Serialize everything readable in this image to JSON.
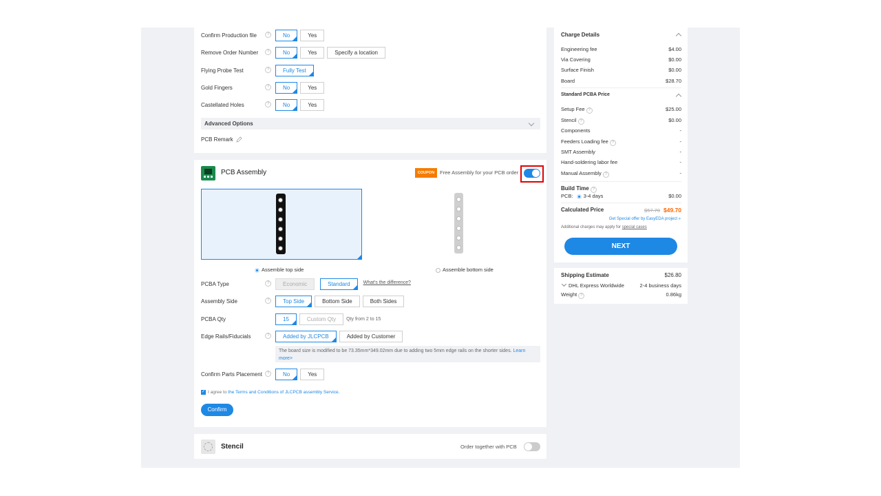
{
  "pcb_options": [
    {
      "label": "Confirm Production file",
      "options": [
        "No",
        "Yes"
      ],
      "selected": 0
    },
    {
      "label": "Remove Order Number",
      "options": [
        "No",
        "Yes",
        "Specify a location"
      ],
      "selected": 0
    },
    {
      "label": "Flying Probe Test",
      "options": [
        "Fully Test"
      ],
      "selected": 0
    },
    {
      "label": "Gold Fingers",
      "options": [
        "No",
        "Yes"
      ],
      "selected": 0
    },
    {
      "label": "Castellated Holes",
      "options": [
        "No",
        "Yes"
      ],
      "selected": 0
    }
  ],
  "advanced_options": "Advanced Options",
  "pcb_remark": "PCB Remark",
  "assembly": {
    "title": "PCB Assembly",
    "coupon_badge": "COUPON",
    "free_text": "Free Assembly for your PCB order",
    "toggle_on": true,
    "top_side_label": "Assemble top side",
    "bottom_side_label": "Assemble bottom side",
    "pcba_type": {
      "label": "PCBA Type",
      "options": [
        "Economic",
        "Standard"
      ],
      "selected": 1,
      "link": "What's the difference?"
    },
    "assembly_side": {
      "label": "Assembly Side",
      "options": [
        "Top Side",
        "Bottom Side",
        "Both Sides"
      ],
      "selected": 0
    },
    "pcba_qty": {
      "label": "PCBA Qty",
      "value": "15",
      "custom_placeholder": "Custom Qty",
      "hint": "Qty from 2 to 15"
    },
    "edge_rails": {
      "label": "Edge Rails/Fiducials",
      "options": [
        "Added by JLCPCB",
        "Added by Customer"
      ],
      "selected": 0
    },
    "edge_note_a": "The board size is modified to be 73.35mm*349.02mm due to adding two 5mm edge rails on the shorter sides.",
    "edge_note_link_a": "Learn",
    "edge_note_link_b": "more>",
    "confirm_parts": {
      "label": "Confirm Parts Placement",
      "options": [
        "No",
        "Yes"
      ],
      "selected": 0
    },
    "agree_prefix": "I agree to",
    "agree_link": "the Terms and Conditions of JLCPCB assembly Service.",
    "confirm_button": "Confirm"
  },
  "stencil": {
    "title": "Stencil",
    "order_together": "Order together with PCB",
    "toggle_on": false
  },
  "charge": {
    "title": "Charge Details",
    "items": [
      {
        "label": "Engineering fee",
        "value": "$4.00"
      },
      {
        "label": "Via Covering",
        "value": "$0.00"
      },
      {
        "label": "Surface Finish",
        "value": "$0.00"
      },
      {
        "label": "Board",
        "value": "$28.70"
      }
    ],
    "pcba_title": "Standard PCBA Price",
    "pcba_items": [
      {
        "label": "Setup Fee",
        "value": "$25.00",
        "help": true
      },
      {
        "label": "Stencil",
        "value": "$0.00",
        "help": true
      },
      {
        "label": "Components",
        "value": "-",
        "help": false
      },
      {
        "label": "Feeders Loading fee",
        "value": "-",
        "help": true
      },
      {
        "label": "SMT Assembly",
        "value": "-",
        "help": false
      },
      {
        "label": "Hand-soldering labor fee",
        "value": "-",
        "help": false
      },
      {
        "label": "Manual Assembly",
        "value": "-",
        "help": true
      }
    ],
    "build_time_title": "Build Time",
    "build_pcb_label": "PCB:",
    "build_pcb_days": "3-4 days",
    "build_pcb_price": "$0.00",
    "calculated_title": "Calculated Price",
    "old_price": "$57.70",
    "new_price": "$49.70",
    "special_offer": "Get Special offer by EasyEDA project »",
    "additional_prefix": "Additional charges may apply for",
    "additional_link": "special cases",
    "next_button": "NEXT"
  },
  "shipping": {
    "title": "Shipping Estimate",
    "price": "$26.80",
    "method": "DHL Express Worldwide",
    "days": "2-4 business days",
    "weight_label": "Weight",
    "weight": "0.86kg"
  },
  "colors": {
    "accent": "#1e88e5",
    "price": "#ff6600",
    "highlight": "#e00000"
  }
}
